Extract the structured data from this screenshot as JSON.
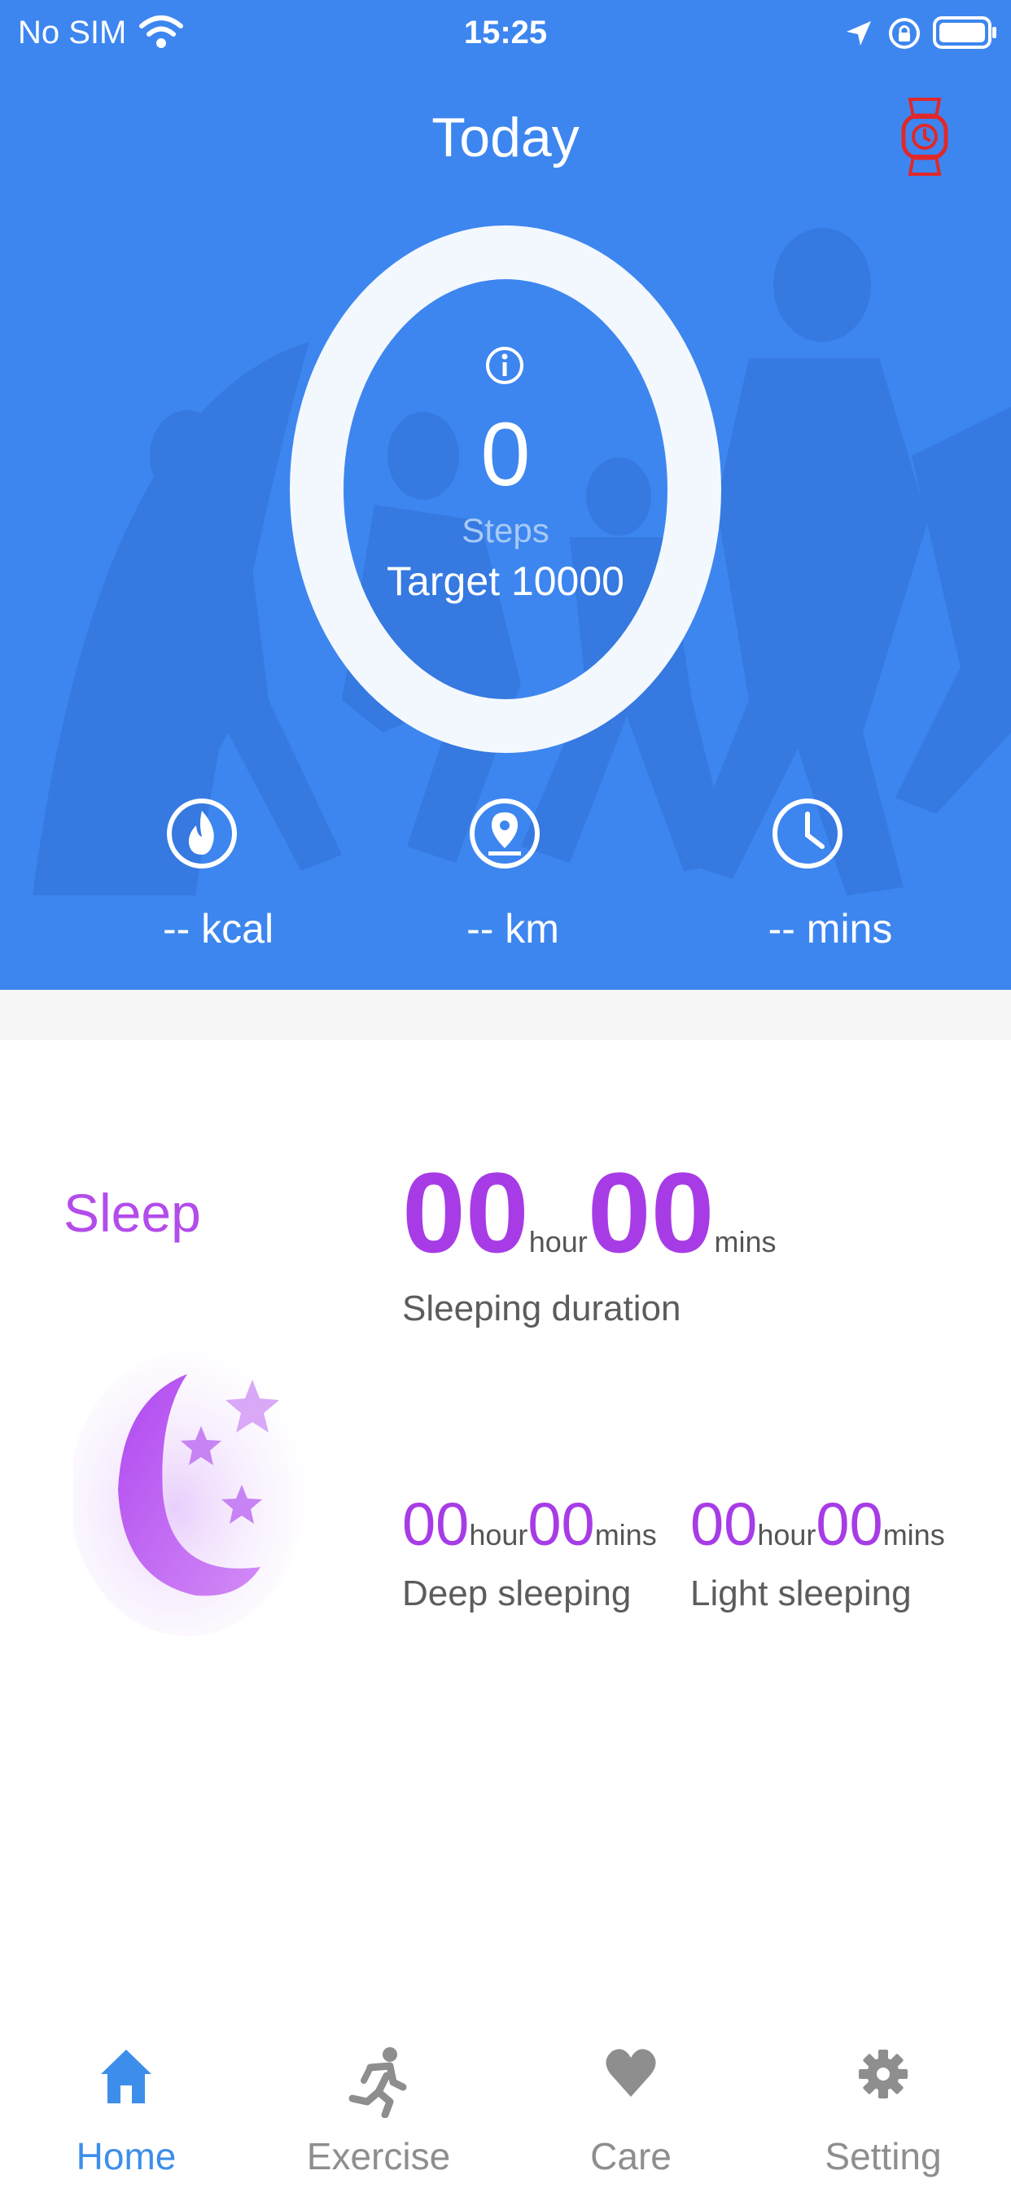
{
  "status_bar": {
    "carrier": "No SIM",
    "time": "15:25",
    "icons": [
      "wifi-icon",
      "location-arrow-icon",
      "orientation-lock-icon",
      "battery-icon"
    ]
  },
  "header": {
    "title": "Today",
    "watch_icon": "watch-icon",
    "watch_icon_color": "#e0282a"
  },
  "steps": {
    "value": "0",
    "label": "Steps",
    "target": "Target 10000",
    "progress": 0
  },
  "stats": [
    {
      "icon": "flame-icon",
      "label": "-- kcal"
    },
    {
      "icon": "location-pin-icon",
      "label": "-- km"
    },
    {
      "icon": "clock-icon",
      "label": "-- mins"
    }
  ],
  "sleep": {
    "title": "Sleep",
    "duration": {
      "hours": "00",
      "hour_unit": "hour",
      "mins": "00",
      "mins_unit": "mins",
      "caption": "Sleeping duration"
    },
    "deep": {
      "hours": "00",
      "hour_unit": "hour",
      "mins": "00",
      "mins_unit": "mins",
      "caption": "Deep sleeping"
    },
    "light": {
      "hours": "00",
      "hour_unit": "hour",
      "mins": "00",
      "mins_unit": "mins",
      "caption": "Light sleeping"
    }
  },
  "tabs": [
    {
      "icon": "home-icon",
      "label": "Home",
      "active": true
    },
    {
      "icon": "running-icon",
      "label": "Exercise",
      "active": false
    },
    {
      "icon": "heart-icon",
      "label": "Care",
      "active": false
    },
    {
      "icon": "gear-icon",
      "label": "Setting",
      "active": false
    }
  ],
  "colors": {
    "header_blue": "#3d86ef",
    "sleep_purple": "#a73ce6",
    "tab_active": "#3d8eea",
    "tab_inactive": "#8e8e8e"
  }
}
